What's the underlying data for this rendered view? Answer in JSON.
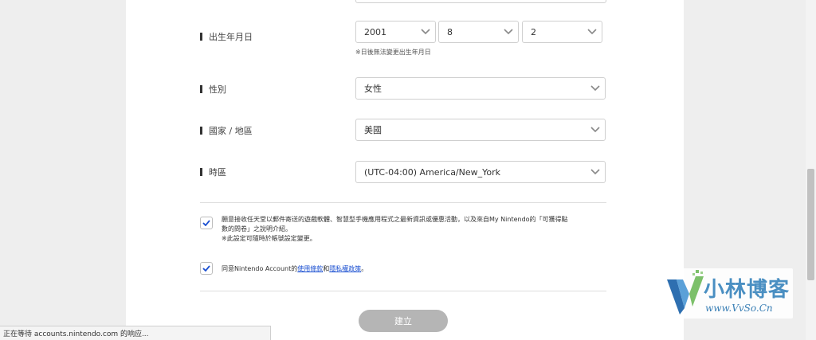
{
  "form": {
    "birthdate": {
      "label": "出生年月日",
      "year": "2001",
      "month": "8",
      "day": "2",
      "note": "※日後無法變更出生年月日"
    },
    "gender": {
      "label": "性別",
      "value": "女性"
    },
    "country": {
      "label": "國家 / 地區",
      "value": "美國"
    },
    "timezone": {
      "label": "時區",
      "value": "(UTC-04:00) America/New_York"
    },
    "newsletter": {
      "checked": true,
      "line1": "願意接收任天堂以郵件寄送的遊戲軟體、智慧型手機應用程式之最新資訊或優惠活動，以及來自My Nintendo的「可獲得點",
      "line2": "數的問卷」之說明介紹。",
      "line3": "※此設定可隨時於帳號設定變更。"
    },
    "terms": {
      "checked": true,
      "prefix": "同意Nintendo Account的",
      "terms_link": "使用條款",
      "and": "和",
      "privacy_link": "隱私權政策",
      "suffix": "。"
    },
    "create_label": "建立"
  },
  "status_bar": {
    "text": "正在等待 accounts.nintendo.com 的响应..."
  },
  "watermark": {
    "title": "小林博客",
    "url": "www.VvSo.Cn"
  },
  "colors": {
    "page_bg": "#eeeeee",
    "card_bg": "#ffffff",
    "check_blue": "#1a4fd1",
    "button_disabled": "#b5b5b5",
    "watermark_blue": "#4a8fc2"
  },
  "icons": {
    "dropdown": "chevron-down-icon",
    "checkbox_mark": "check-icon"
  }
}
